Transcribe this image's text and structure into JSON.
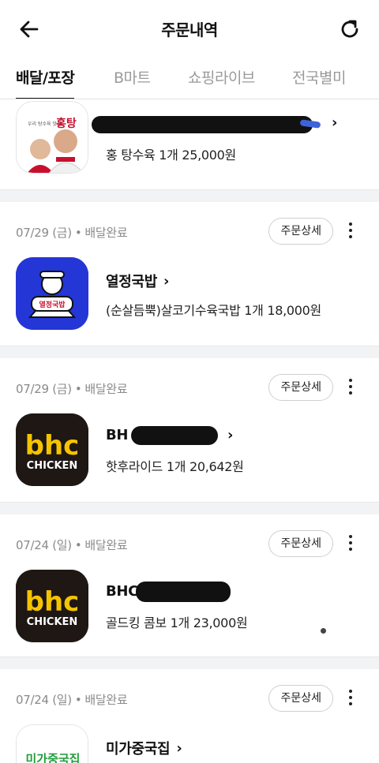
{
  "header": {
    "title": "주문내역",
    "back_icon": "arrow-left-icon",
    "refresh_icon": "refresh-icon"
  },
  "tabs": [
    {
      "label": "배달/포장",
      "active": true
    },
    {
      "label": "B마트",
      "active": false
    },
    {
      "label": "쇼핑라이브",
      "active": false
    },
    {
      "label": "전국별미",
      "active": false
    }
  ],
  "orders": [
    {
      "date": "",
      "status": "",
      "store": "",
      "menu": "홍 탕수육 1개 25,000원",
      "logo_text": "홍탕"
    },
    {
      "date": "07/29 (금)",
      "status": "배달완료",
      "detail_label": "주문상세",
      "store": "열정국밥",
      "menu": "(순살듬뿍)살코기수육국밥 1개 18,000원",
      "logo_text": "열정국밥"
    },
    {
      "date": "07/29 (금)",
      "status": "배달완료",
      "detail_label": "주문상세",
      "store": "BH",
      "menu": "핫후라이드 1개 20,642원",
      "logo_text_top": "bhc",
      "logo_text_bottom": "CHICKEN"
    },
    {
      "date": "07/24 (일)",
      "status": "배달완료",
      "detail_label": "주문상세",
      "store": "BHC",
      "menu": "골드킹 콤보 1개 23,000원",
      "logo_text_top": "bhc",
      "logo_text_bottom": "CHICKEN"
    },
    {
      "date": "07/24 (일)",
      "status": "배달완료",
      "detail_label": "주문상세",
      "store": "미가중국집",
      "menu": "",
      "logo_text": "미가중국집"
    }
  ],
  "colors": {
    "bhc_yellow": "#f5c400",
    "bhc_bg": "#1e1714",
    "yeoljeong_blue": "#2436d6",
    "accent_red": "#c8102e"
  }
}
